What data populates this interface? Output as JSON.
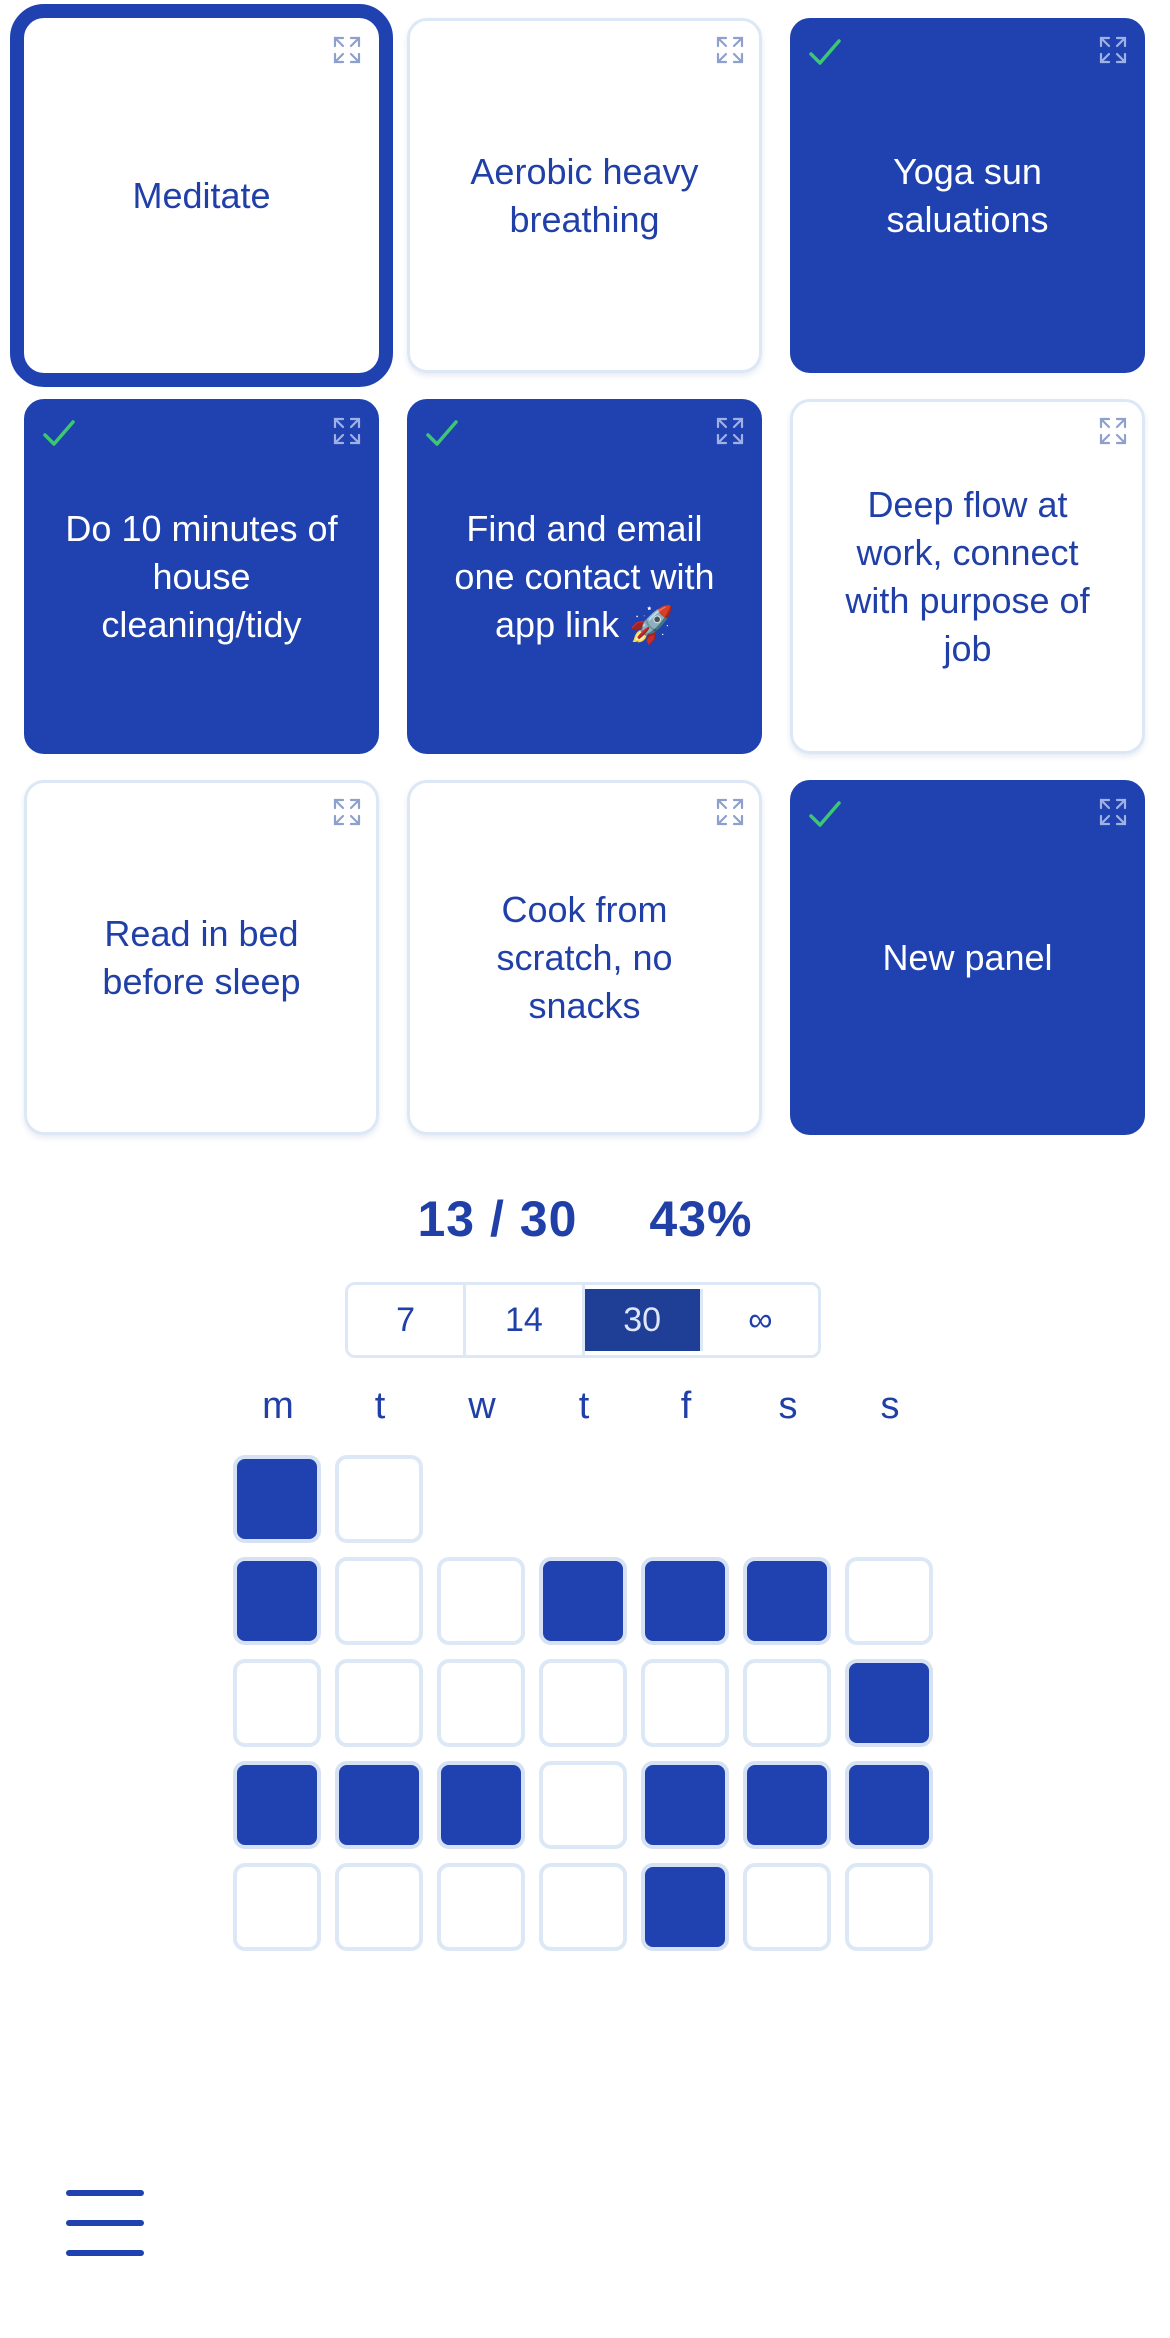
{
  "panels": [
    {
      "label": "Meditate",
      "done": false,
      "selected": true
    },
    {
      "label": "Aerobic heavy breathing",
      "done": false,
      "selected": false
    },
    {
      "label": "Yoga sun saluations",
      "done": true,
      "selected": false
    },
    {
      "label": "Do 10 minutes of house cleaning/tidy",
      "done": true,
      "selected": false
    },
    {
      "label": "Find and email one contact with app link 🚀",
      "done": true,
      "selected": false
    },
    {
      "label": "Deep flow at work, connect with purpose of job",
      "done": false,
      "selected": false
    },
    {
      "label": "Read in bed before sleep",
      "done": false,
      "selected": false
    },
    {
      "label": "Cook from scratch, no snacks",
      "done": false,
      "selected": false
    },
    {
      "label": "New panel",
      "done": true,
      "selected": false
    }
  ],
  "stats": {
    "count": "13 / 30",
    "percent": "43%"
  },
  "range_tabs": [
    {
      "label": "7",
      "active": false
    },
    {
      "label": "14",
      "active": false
    },
    {
      "label": "30",
      "active": true
    },
    {
      "label": "∞",
      "active": false
    }
  ],
  "weekdays": [
    "m",
    "t",
    "w",
    "t",
    "f",
    "s",
    "s"
  ],
  "calendar": {
    "weeks": [
      [
        true,
        false,
        null,
        null,
        null,
        null,
        null
      ],
      [
        true,
        false,
        false,
        true,
        true,
        true,
        false
      ],
      [
        false,
        false,
        false,
        false,
        false,
        false,
        true
      ],
      [
        true,
        true,
        true,
        false,
        true,
        true,
        true
      ],
      [
        false,
        false,
        false,
        false,
        true,
        false,
        false
      ]
    ]
  },
  "colors": {
    "accent": "#1f42b0",
    "check": "#3cc870",
    "border": "#dde8f6"
  },
  "icons": {
    "expand": "expand-icon",
    "check": "check-icon",
    "menu": "hamburger-menu-icon"
  }
}
